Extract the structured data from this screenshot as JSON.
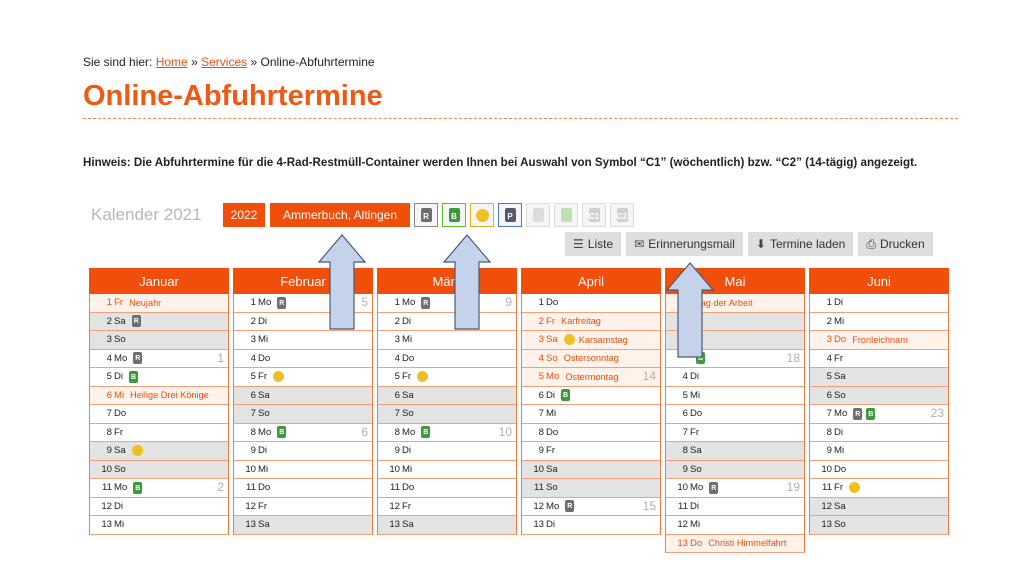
{
  "breadcrumb": {
    "prefix": "Sie sind hier:",
    "home": "Home",
    "sep1": "»",
    "services": "Services",
    "sep2": "»",
    "current": "Online-Abfuhrtermine"
  },
  "page_title": "Online-Abfuhrtermine",
  "hint": "Hinweis: Die Abfuhrtermine für die 4-Rad-Restmüll-Container werden Ihnen bei Auswahl von Symbol “C1” (wöchentlich) bzw. “C2” (14-tägig) angezeigt.",
  "calendar": {
    "title": "Kalender 2021",
    "year_button": "2022",
    "area_button": "Ammerbuch, Altingen",
    "filters": [
      {
        "name": "filter-restmuell",
        "letter": "R",
        "color": "#6e6e6e",
        "border": "#888"
      },
      {
        "name": "filter-bio",
        "letter": "B",
        "color": "#3c9a3c",
        "border": "#5bbf2a"
      },
      {
        "name": "filter-gelber-sack",
        "letter": "",
        "color": "#f0c020",
        "border": "#e0b020"
      },
      {
        "name": "filter-papier",
        "letter": "P",
        "color": "#555a6e",
        "border": "#4a78c8"
      },
      {
        "name": "filter-altkleider",
        "letter": "",
        "color": "#dcdcdc",
        "border": "#ddd"
      },
      {
        "name": "filter-gruen",
        "letter": "",
        "color": "#bfe0b0",
        "border": "#ddd"
      },
      {
        "name": "filter-c1",
        "letter": "C1",
        "color": "#d0d0d0",
        "border": "#ddd"
      },
      {
        "name": "filter-c2",
        "letter": "C2",
        "color": "#d0d0d0",
        "border": "#ddd"
      }
    ],
    "actions": {
      "list": "Liste",
      "reminder": "Erinnerungsmail",
      "download": "Termine laden",
      "print": "Drucken"
    },
    "months": [
      {
        "name": "Januar",
        "days": [
          {
            "d": "1",
            "w": "Fr",
            "type": "hol",
            "label": "Neujahr"
          },
          {
            "d": "2",
            "w": "Sa",
            "type": "we",
            "bins": [
              "rest"
            ]
          },
          {
            "d": "3",
            "w": "So",
            "type": "we"
          },
          {
            "d": "4",
            "w": "Mo",
            "bins": [
              "rest"
            ],
            "wk": "1"
          },
          {
            "d": "5",
            "w": "Di",
            "bins": [
              "bio"
            ]
          },
          {
            "d": "6",
            "w": "Mi",
            "type": "hol",
            "label": "Heilige Drei Könige"
          },
          {
            "d": "7",
            "w": "Do"
          },
          {
            "d": "8",
            "w": "Fr"
          },
          {
            "d": "9",
            "w": "Sa",
            "type": "we",
            "bins": [
              "gelb"
            ]
          },
          {
            "d": "10",
            "w": "So",
            "type": "we"
          },
          {
            "d": "11",
            "w": "Mo",
            "bins": [
              "bio"
            ],
            "wk": "2"
          },
          {
            "d": "12",
            "w": "Di"
          },
          {
            "d": "13",
            "w": "Mi"
          }
        ]
      },
      {
        "name": "Februar",
        "days": [
          {
            "d": "1",
            "w": "Mo",
            "bins": [
              "rest"
            ],
            "wk": "5"
          },
          {
            "d": "2",
            "w": "Di"
          },
          {
            "d": "3",
            "w": "Mi"
          },
          {
            "d": "4",
            "w": "Do"
          },
          {
            "d": "5",
            "w": "Fr",
            "bins": [
              "gelb"
            ]
          },
          {
            "d": "6",
            "w": "Sa",
            "type": "we"
          },
          {
            "d": "7",
            "w": "So",
            "type": "we"
          },
          {
            "d": "8",
            "w": "Mo",
            "bins": [
              "bio"
            ],
            "wk": "6"
          },
          {
            "d": "9",
            "w": "Di"
          },
          {
            "d": "10",
            "w": "Mi"
          },
          {
            "d": "11",
            "w": "Do"
          },
          {
            "d": "12",
            "w": "Fr"
          },
          {
            "d": "13",
            "w": "Sa",
            "type": "we"
          }
        ]
      },
      {
        "name": "März",
        "days": [
          {
            "d": "1",
            "w": "Mo",
            "bins": [
              "rest"
            ],
            "wk": "9"
          },
          {
            "d": "2",
            "w": "Di"
          },
          {
            "d": "3",
            "w": "Mi"
          },
          {
            "d": "4",
            "w": "Do"
          },
          {
            "d": "5",
            "w": "Fr",
            "bins": [
              "gelb"
            ]
          },
          {
            "d": "6",
            "w": "Sa",
            "type": "we"
          },
          {
            "d": "7",
            "w": "So",
            "type": "we"
          },
          {
            "d": "8",
            "w": "Mo",
            "bins": [
              "bio"
            ],
            "wk": "10"
          },
          {
            "d": "9",
            "w": "Di"
          },
          {
            "d": "10",
            "w": "Mi"
          },
          {
            "d": "11",
            "w": "Do"
          },
          {
            "d": "12",
            "w": "Fr"
          },
          {
            "d": "13",
            "w": "Sa",
            "type": "we"
          }
        ]
      },
      {
        "name": "April",
        "days": [
          {
            "d": "1",
            "w": "Do"
          },
          {
            "d": "2",
            "w": "Fr",
            "type": "hol",
            "label": "Karfreitag"
          },
          {
            "d": "3",
            "w": "Sa",
            "type": "hol",
            "bins": [
              "gelb"
            ],
            "label": "Karsamstag"
          },
          {
            "d": "4",
            "w": "So",
            "type": "hol",
            "label": "Ostersonntag"
          },
          {
            "d": "5",
            "w": "Mo",
            "type": "hol",
            "label": "Ostermontag",
            "wk": "14"
          },
          {
            "d": "6",
            "w": "Di",
            "bins": [
              "bio"
            ]
          },
          {
            "d": "7",
            "w": "Mi"
          },
          {
            "d": "8",
            "w": "Do"
          },
          {
            "d": "9",
            "w": "Fr"
          },
          {
            "d": "10",
            "w": "Sa",
            "type": "we"
          },
          {
            "d": "11",
            "w": "So",
            "type": "we"
          },
          {
            "d": "12",
            "w": "Mo",
            "bins": [
              "rest"
            ],
            "wk": "15"
          },
          {
            "d": "13",
            "w": "Di"
          }
        ]
      },
      {
        "name": "Mai",
        "days": [
          {
            "d": "",
            "w": "",
            "type": "hol",
            "label": "Tag der Arbeit"
          },
          {
            "d": "",
            "w": "",
            "type": "we"
          },
          {
            "d": "",
            "w": "",
            "type": "we"
          },
          {
            "d": "",
            "w": "",
            "bins": [
              "bio"
            ],
            "wk": "18"
          },
          {
            "d": "4",
            "w": "Di"
          },
          {
            "d": "5",
            "w": "Mi"
          },
          {
            "d": "6",
            "w": "Do"
          },
          {
            "d": "7",
            "w": "Fr"
          },
          {
            "d": "8",
            "w": "Sa",
            "type": "we"
          },
          {
            "d": "9",
            "w": "So",
            "type": "we"
          },
          {
            "d": "10",
            "w": "Mo",
            "bins": [
              "rest"
            ],
            "wk": "19"
          },
          {
            "d": "11",
            "w": "Di"
          },
          {
            "d": "12",
            "w": "Mi"
          },
          {
            "d": "13",
            "w": "Do",
            "type": "hol",
            "label": "Christi Himmelfahrt"
          }
        ]
      },
      {
        "name": "Juni",
        "days": [
          {
            "d": "1",
            "w": "Di"
          },
          {
            "d": "2",
            "w": "Mi"
          },
          {
            "d": "3",
            "w": "Do",
            "type": "hol",
            "label": "Fronleichnam"
          },
          {
            "d": "4",
            "w": "Fr"
          },
          {
            "d": "5",
            "w": "Sa",
            "type": "we"
          },
          {
            "d": "6",
            "w": "So",
            "type": "we"
          },
          {
            "d": "7",
            "w": "Mo",
            "bins": [
              "rest",
              "bio"
            ],
            "wk": "23"
          },
          {
            "d": "8",
            "w": "Di"
          },
          {
            "d": "9",
            "w": "Mi"
          },
          {
            "d": "10",
            "w": "Do"
          },
          {
            "d": "11",
            "w": "Fr",
            "bins": [
              "gelb"
            ]
          },
          {
            "d": "12",
            "w": "Sa",
            "type": "we"
          },
          {
            "d": "13",
            "w": "So",
            "type": "we"
          }
        ]
      }
    ]
  },
  "colors": {
    "accent": "#f04e0a",
    "arrow_fill": "#c5d3ea",
    "arrow_stroke": "#4a5a78"
  }
}
